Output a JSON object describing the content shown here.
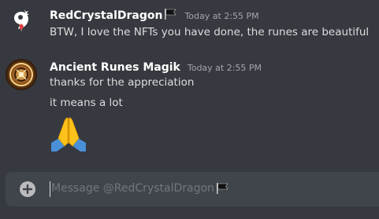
{
  "colors": {
    "background": "#36393f",
    "input_background": "#40444b",
    "username": "#ffffff",
    "message_text": "#dcddde",
    "timestamp": "#a3a6aa",
    "placeholder": "#72767d"
  },
  "messages": [
    {
      "username": "RedCrystalDragon",
      "flag_icon": "black-flag-icon",
      "timestamp": "Today at 2:55 PM",
      "lines": [
        "BTW, I love the NFTs you have done, the runes are beautiful"
      ]
    },
    {
      "username": "Ancient Runes Magik",
      "timestamp": "Today at 2:55 PM",
      "lines": [
        "thanks for the appreciation",
        "it means a lot"
      ],
      "emoji": "folded-hands-emoji"
    }
  ],
  "composer": {
    "placeholder": "Message @RedCrystalDragon",
    "flag_icon": "black-flag-icon",
    "add_icon": "plus-circle-icon"
  }
}
